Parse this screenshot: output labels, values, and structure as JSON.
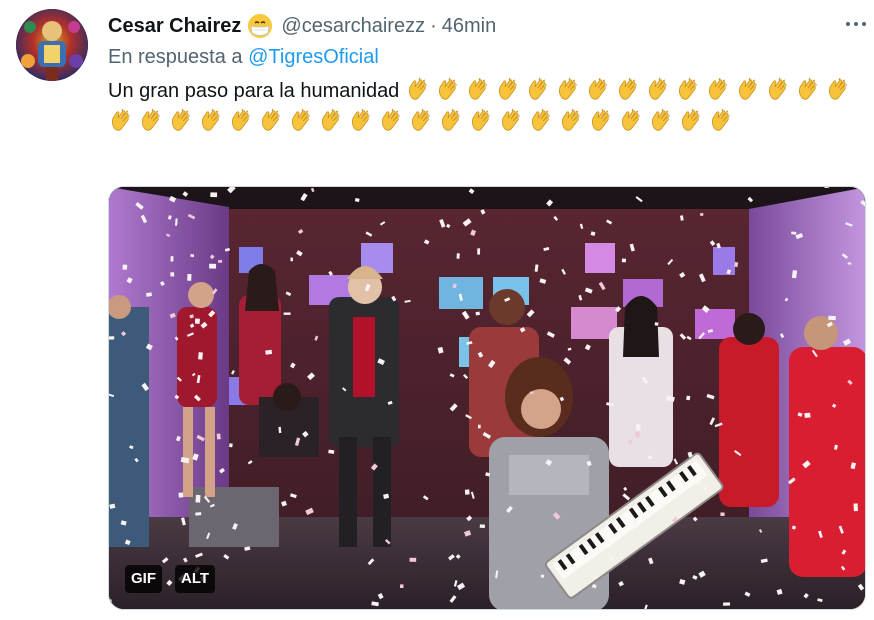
{
  "tweet": {
    "display_name": "Cesar Chairez",
    "name_emoji": "face-with-medical-mask-emoji",
    "handle": "@cesarchairezz",
    "separator": "·",
    "time": "46min",
    "reply_prefix": "En respuesta a",
    "reply_to": "@TigresOficial",
    "text": "Un gran paso para la humanidad",
    "clap_count": 36,
    "clap_emoji": "clapping-hands-emoji"
  },
  "media": {
    "type": "gif",
    "gif_badge": "GIF",
    "alt_badge": "ALT"
  },
  "colors": {
    "text": "#0f1419",
    "secondary": "#536471",
    "link": "#1d9bf0",
    "clap_yellow": "#f7c23c"
  }
}
